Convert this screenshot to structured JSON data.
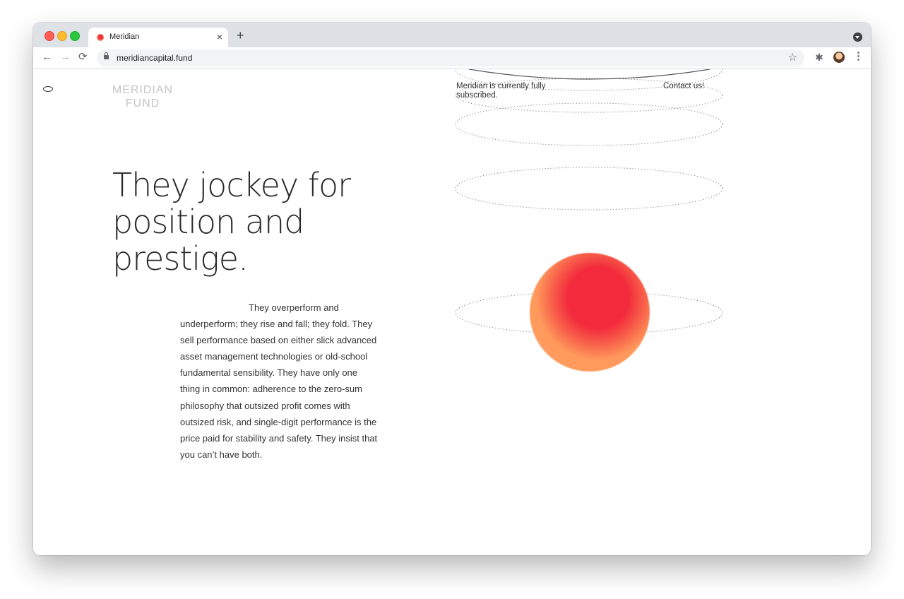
{
  "browser": {
    "tab_title": "Meridian",
    "new_tab_label": "+",
    "close_tab_label": "×",
    "url": "meridiancapital.fund",
    "back_label": "←",
    "forward_label": "→",
    "reload_label": "⟳",
    "star_label": "☆",
    "extensions_label": "✱",
    "menu_label": "⋮"
  },
  "site": {
    "logo": "MERIDIAN FUND",
    "notice": "Meridian is currently fully subscribed.",
    "contact_label": "Contact us!",
    "headline": "They jockey for position and prestige.",
    "body": "They overperform and underperform; they rise and fall; they fold. They sell performance based on either slick advanced asset management technologies or old-school fundamental sensibility. They have only one thing in common: adherence to the zero-sum philosophy that outsized profit comes with outsized risk, and single-digit performance is the price paid for stability and safety. They insist that you can’t have both."
  },
  "colors": {
    "planet_core": "#f22a3c",
    "planet_rim": "#ff9e60",
    "logo_text": "#c4c4c4",
    "text": "#2b2b2b"
  }
}
